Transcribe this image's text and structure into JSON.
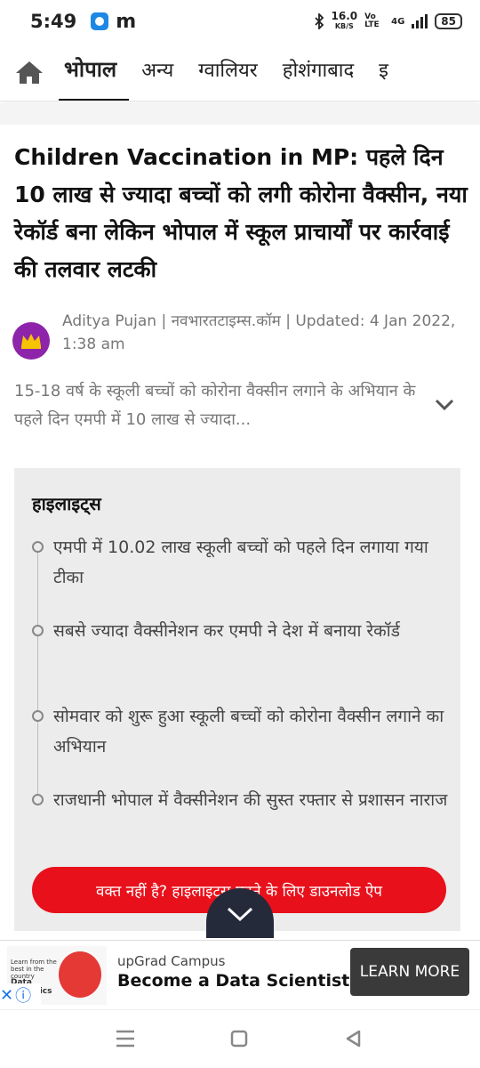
{
  "status_bar": {
    "time": "5:49",
    "app_letter": "m",
    "speed_value": "16.0",
    "speed_unit": "KB/S",
    "volte": "Vo LTE",
    "network": "4G",
    "battery": "85"
  },
  "nav": {
    "tabs": [
      "भोपाल",
      "अन्य",
      "ग्वालियर",
      "होशंगाबाद",
      "इ"
    ]
  },
  "article": {
    "headline": "Children Vaccination in MP: पहले दिन 10 लाख से ज्यादा बच्चों को लगी कोरोना वैक्सीन, नया रेकॉर्ड बना लेकिन भोपाल में स्कूल प्राचार्यों पर कार्रवाई की तलवार लटकी",
    "byline": "Aditya Pujan | नवभारतटाइम्स.कॉम | Updated: 4 Jan 2022, 1:38 am",
    "summary": "15-18 वर्ष के स्कूली बच्चों को कोरोना वैक्सीन लगाने के अभियान के पहले दिन एमपी में 10 लाख से ज्यादा..."
  },
  "highlights": {
    "title": "हाइलाइट्स",
    "items": [
      "एमपी में 10.02 लाख स्कूली बच्चों को पहले दिन लगाया गया टीका",
      "सबसे ज्यादा वैक्सीनेशन कर एमपी ने देश में बनाया रेकॉर्ड",
      "सोमवार को शुरू हुआ स्कूली बच्चों को कोरोना वैक्सीन लगाने का अभियान",
      "राजधानी भोपाल में वैक्सीनेशन की सुस्त रफ्तार से प्रशासन नाराज"
    ],
    "cta": "वक्त नहीं है? हाइलाइट्स पढ़ने के लिए डाउनलोड ऐप"
  },
  "ad": {
    "source": "upGrad Campus",
    "title": "Become a Data Scientist",
    "button": "LEARN MORE",
    "image_text_1": "Learn from the best in the country",
    "image_text_2": "Data Analytics"
  },
  "colors": {
    "accent_red": "#e8111b",
    "highlight_bg": "#ececec",
    "avatar_purple": "#8e24aa"
  }
}
